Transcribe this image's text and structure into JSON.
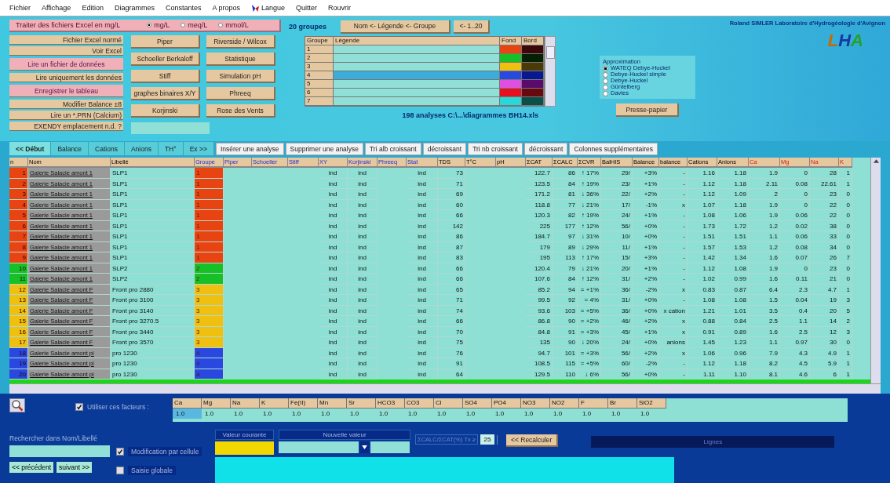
{
  "menu": [
    {
      "label": "Fichier"
    },
    {
      "label": "Affichage"
    },
    {
      "label": "Edition"
    },
    {
      "label": "Diagrammes"
    },
    {
      "label": "Constantes"
    },
    {
      "label": "A propos"
    },
    {
      "label": "Langue",
      "kind": "flag"
    },
    {
      "label": "Quitter"
    },
    {
      "label": "Rouvrir"
    }
  ],
  "excel_bar": {
    "label": "Traiter des fichiers Excel en mg/L",
    "units": [
      {
        "label": "mg/L",
        "selected": true
      },
      {
        "label": "meq/L",
        "selected": false
      },
      {
        "label": "mmol/L",
        "selected": false
      }
    ]
  },
  "file_buttons": [
    {
      "label": "Fichier Excel normé",
      "kind": "plain"
    },
    {
      "label": "Voir Excel",
      "kind": "plain"
    },
    {
      "label": "Lire un fichier de données",
      "kind": "pink"
    },
    {
      "label": "Lire uniquement les données",
      "kind": "plain"
    },
    {
      "label": "Enregistrer le tableau",
      "kind": "pink"
    },
    {
      "label": "Modifier Balance ±8",
      "kind": "plain"
    },
    {
      "label": "Lire un *.PRN (Calcium)",
      "kind": "plain"
    },
    {
      "label": "EXENDY emplacement n.d. ?",
      "kind": "plain"
    }
  ],
  "diagram_buttons": [
    "Piper",
    "Schoeller Berkaloff",
    "Stiff",
    "graphes binaires X/Y",
    "Korjinski"
  ],
  "tool_buttons": [
    "Riverside / Wilcox",
    "Statistique",
    "Simulation pH",
    "Phreeq",
    "Rose des Vents"
  ],
  "file_path": "198 analyses C:\\...\\diagrammes BH14.xls",
  "groups": {
    "count": "20 groupes",
    "name_button": "Nom <- Légende <- Groupe",
    "range_button": "<- 1..20",
    "columns": [
      "Groupe",
      "Légende",
      "Fond",
      "Bord"
    ],
    "rows": [
      {
        "groupe": "1",
        "swatches": [
          {
            "color": "#e84412"
          },
          {
            "color": "#3a0808"
          }
        ],
        "selected": false
      },
      {
        "groupe": "2",
        "swatches": [
          {
            "color": "#18c028"
          },
          {
            "color": "#062006"
          }
        ],
        "selected": false
      },
      {
        "groupe": "3",
        "swatches": [
          {
            "color": "#f0c010"
          },
          {
            "color": "#4a3a08"
          }
        ],
        "selected": false
      },
      {
        "groupe": "4",
        "swatches": [
          {
            "color": "#2848e0"
          },
          {
            "color": "#081890"
          }
        ],
        "selected": true
      },
      {
        "groupe": "5",
        "swatches": [
          {
            "color": "#e050e0"
          },
          {
            "color": "#5a0a6a"
          }
        ],
        "selected": false
      },
      {
        "groupe": "6",
        "swatches": [
          {
            "color": "#e81020"
          },
          {
            "color": "#6a0810"
          }
        ],
        "selected": false
      },
      {
        "groupe": "7",
        "swatches": [
          {
            "color": "#28d8d8"
          },
          {
            "color": "#0a5048"
          }
        ],
        "selected": false
      }
    ]
  },
  "approximation": {
    "title": "Approximation",
    "options": [
      {
        "label": "WATEQ Debye-Huckel",
        "selected": true
      },
      {
        "label": "Debye-Huckel simple",
        "selected": false
      },
      {
        "label": "Debye-Huckel",
        "selected": false
      },
      {
        "label": "Güntelberg",
        "selected": false
      },
      {
        "label": "Davies",
        "selected": false
      }
    ],
    "clipboard_button": "Presse-papier"
  },
  "author": "Roland SIMLER Laboratoire d'Hydrogéologie d'Avignon",
  "logo": [
    {
      "letter": "L",
      "color": "#c86a00"
    },
    {
      "letter": "H",
      "color": "#1838a0"
    },
    {
      "letter": "A",
      "color": "#28a028"
    }
  ],
  "tabs": [
    {
      "label": "<< Début",
      "selected": true
    },
    {
      "label": "Balance",
      "selected": false
    },
    {
      "label": "Cations",
      "selected": false
    },
    {
      "label": "Anions",
      "selected": false
    },
    {
      "label": "TH°",
      "selected": false
    },
    {
      "label": "Ex >>",
      "selected": false
    }
  ],
  "actions": [
    "Insérer une analyse",
    "Supprimer une analyse",
    "Tri alb croissant",
    "décroissant",
    "Tri nb croissant",
    "décroissant",
    "Colonnes supplémentaires"
  ],
  "table": {
    "columns": [
      {
        "label": "n",
        "kind": "plain"
      },
      {
        "label": "Nom",
        "kind": "plain"
      },
      {
        "label": "Libellé",
        "kind": "plain"
      },
      {
        "label": "Groupe",
        "kind": "plot"
      },
      {
        "label": "Piper",
        "kind": "plot"
      },
      {
        "label": "Schoeller",
        "kind": "plot"
      },
      {
        "label": "Stiff",
        "kind": "plot"
      },
      {
        "label": "XY",
        "kind": "plot"
      },
      {
        "label": "Korjinski",
        "kind": "plot"
      },
      {
        "label": "Phreeq",
        "kind": "plot"
      },
      {
        "label": "Stat",
        "kind": "plot"
      },
      {
        "label": "TDS",
        "kind": "plain"
      },
      {
        "label": "T°C",
        "kind": "plain"
      },
      {
        "label": "pH",
        "kind": "plain"
      },
      {
        "label": "ΣCAT",
        "kind": "plain"
      },
      {
        "label": "ΣCALC",
        "kind": "plain"
      },
      {
        "label": "ΣCVR",
        "kind": "plain"
      },
      {
        "label": "BalHIS",
        "kind": "plain"
      },
      {
        "label": "Balance",
        "kind": "plain"
      },
      {
        "label": "balance",
        "kind": "plain"
      },
      {
        "label": "Cations",
        "kind": "plain"
      },
      {
        "label": "Anions",
        "kind": "plain"
      },
      {
        "label": "Ca",
        "kind": "ion"
      },
      {
        "label": "Mg",
        "kind": "ion"
      },
      {
        "label": "Na",
        "kind": "ion"
      },
      {
        "label": "K",
        "kind": "ion"
      }
    ],
    "rows": [
      {
        "color": "#e84412",
        "n": "1",
        "nom": "Galerie Salacie amont 1",
        "lib": "SLP1",
        "grp": "1",
        "xy": "ind",
        "kor": "ind",
        "stat": "ind",
        "tds": "73",
        "cat": "122.7",
        "calc": "86",
        "cvr": "↑ 17%",
        "bh": "29/",
        "bal": "+3%",
        "rem": "-",
        "cations": "1.16",
        "anions": "1.18",
        "ca": "1.9",
        "mg": "0",
        "na": "28",
        "k": "1"
      },
      {
        "color": "#e84412",
        "n": "2",
        "nom": "Galerie Salacie amont 1",
        "lib": "SLP1",
        "grp": "1",
        "xy": "ind",
        "kor": "ind",
        "stat": "ind",
        "tds": "71",
        "cat": "123.5",
        "calc": "84",
        "cvr": "↑ 19%",
        "bh": "23/",
        "bal": "+1%",
        "rem": "-",
        "cations": "1.12",
        "anions": "1.18",
        "ca": "2.11",
        "mg": "0.08",
        "na": "22.61",
        "k": "1"
      },
      {
        "color": "#e84412",
        "n": "3",
        "nom": "Galerie Salacie amont 1",
        "lib": "SLP1",
        "grp": "1",
        "xy": "ind",
        "kor": "ind",
        "stat": "ind",
        "tds": "69",
        "cat": "171.2",
        "calc": "81",
        "cvr": "↓ 36%",
        "bh": "22/",
        "bal": "+2%",
        "rem": "-",
        "cations": "1.12",
        "anions": "1.09",
        "ca": "2",
        "mg": "0",
        "na": "23",
        "k": "0"
      },
      {
        "color": "#e84412",
        "n": "4",
        "nom": "Galerie Salacie amont 1",
        "lib": "SLP1",
        "grp": "1",
        "xy": "ind",
        "kor": "ind",
        "stat": "ind",
        "tds": "60",
        "cat": "118.8",
        "calc": "77",
        "cvr": "↓ 21%",
        "bh": "17/",
        "bal": "-1%",
        "rem": "x",
        "cations": "1.07",
        "anions": "1.18",
        "ca": "1.9",
        "mg": "0",
        "na": "22",
        "k": "0"
      },
      {
        "color": "#e84412",
        "n": "5",
        "nom": "Galerie Salacie amont 1",
        "lib": "SLP1",
        "grp": "1",
        "xy": "ind",
        "kor": "ind",
        "stat": "ind",
        "tds": "66",
        "cat": "120.3",
        "calc": "82",
        "cvr": "↑ 19%",
        "bh": "24/",
        "bal": "+1%",
        "rem": "-",
        "cations": "1.08",
        "anions": "1.06",
        "ca": "1.9",
        "mg": "0.06",
        "na": "22",
        "k": "0"
      },
      {
        "color": "#e84412",
        "n": "6",
        "nom": "Galerie Salacie amont 1",
        "lib": "SLP1",
        "grp": "1",
        "xy": "ind",
        "kor": "ind",
        "stat": "ind",
        "tds": "142",
        "cat": "225",
        "calc": "177",
        "cvr": "↑ 12%",
        "bh": "56/",
        "bal": "+0%",
        "rem": "-",
        "cations": "1.73",
        "anions": "1.72",
        "ca": "1.2",
        "mg": "0.02",
        "na": "38",
        "k": "0"
      },
      {
        "color": "#e84412",
        "n": "7",
        "nom": "Galerie Salacie amont 1",
        "lib": "SLP1",
        "grp": "1",
        "xy": "ind",
        "kor": "ind",
        "stat": "ind",
        "tds": "86",
        "cat": "184.7",
        "calc": "97",
        "cvr": "↓ 31%",
        "bh": "10/",
        "bal": "+0%",
        "rem": "-",
        "cations": "1.51",
        "anions": "1.51",
        "ca": "1.1",
        "mg": "0.06",
        "na": "33",
        "k": "0"
      },
      {
        "color": "#e84412",
        "n": "8",
        "nom": "Galerie Salacie amont 1",
        "lib": "SLP1",
        "grp": "1",
        "xy": "ind",
        "kor": "ind",
        "stat": "ind",
        "tds": "87",
        "cat": "179",
        "calc": "89",
        "cvr": "↓ 29%",
        "bh": "11/",
        "bal": "+1%",
        "rem": "-",
        "cations": "1.57",
        "anions": "1.53",
        "ca": "1.2",
        "mg": "0.08",
        "na": "34",
        "k": "0"
      },
      {
        "color": "#e84412",
        "n": "9",
        "nom": "Galerie Salacie amont 1",
        "lib": "SLP1",
        "grp": "1",
        "xy": "ind",
        "kor": "ind",
        "stat": "ind",
        "tds": "83",
        "cat": "195",
        "calc": "113",
        "cvr": "↑ 17%",
        "bh": "15/",
        "bal": "+3%",
        "rem": "-",
        "cations": "1.42",
        "anions": "1.34",
        "ca": "1.6",
        "mg": "0.07",
        "na": "26",
        "k": "7"
      },
      {
        "color": "#18c028",
        "n": "10",
        "nom": "Galerie Salacie amont 1",
        "lib": "SLP2",
        "grp": "2",
        "xy": "ind",
        "kor": "ind",
        "stat": "ind",
        "tds": "66",
        "cat": "120.4",
        "calc": "79",
        "cvr": "↓ 21%",
        "bh": "20/",
        "bal": "+1%",
        "rem": "-",
        "cations": "1.12",
        "anions": "1.08",
        "ca": "1.9",
        "mg": "0",
        "na": "23",
        "k": "0"
      },
      {
        "color": "#18c028",
        "n": "11",
        "nom": "Galerie Salacie amont 1",
        "lib": "SLP2",
        "grp": "2",
        "xy": "ind",
        "kor": "ind",
        "stat": "ind",
        "tds": "66",
        "cat": "107.6",
        "calc": "84",
        "cvr": "↑ 12%",
        "bh": "31/",
        "bal": "+2%",
        "rem": "-",
        "cations": "1.02",
        "anions": "0.99",
        "ca": "1.6",
        "mg": "0.11",
        "na": "21",
        "k": "0"
      },
      {
        "color": "#f0c010",
        "n": "12",
        "nom": "Galerie Salacie amont F",
        "lib": "Front pro 2880",
        "grp": "3",
        "xy": "ind",
        "kor": "ind",
        "stat": "ind",
        "tds": "65",
        "cat": "85.2",
        "calc": "94",
        "cvr": "= +1%",
        "bh": "36/",
        "bal": "-2%",
        "rem": "x",
        "cations": "0.83",
        "anions": "0.87",
        "ca": "6.4",
        "mg": "2.3",
        "na": "4.7",
        "k": "1"
      },
      {
        "color": "#f0c010",
        "n": "13",
        "nom": "Galerie Salacie amont F",
        "lib": "Front pro 3100",
        "grp": "3",
        "xy": "ind",
        "kor": "ind",
        "stat": "ind",
        "tds": "71",
        "cat": "99.5",
        "calc": "92",
        "cvr": "= 4%",
        "bh": "31/",
        "bal": "+0%",
        "rem": "-",
        "cations": "1.08",
        "anions": "1.08",
        "ca": "1.5",
        "mg": "0.04",
        "na": "19",
        "k": "3"
      },
      {
        "color": "#f0c010",
        "n": "14",
        "nom": "Galerie Salacie amont F",
        "lib": "Front pro 3140",
        "grp": "3",
        "xy": "ind",
        "kor": "ind",
        "stat": "ind",
        "tds": "74",
        "cat": "93.6",
        "calc": "103",
        "cvr": "= +5%",
        "bh": "36/",
        "bal": "+0%",
        "rem": "x cation",
        "cations": "1.21",
        "anions": "1.01",
        "ca": "3.5",
        "mg": "0.4",
        "na": "20",
        "k": "5"
      },
      {
        "color": "#f0c010",
        "n": "15",
        "nom": "Galerie Salacie amont F",
        "lib": "Front pro 3270.5",
        "grp": "3",
        "xy": "ind",
        "kor": "ind",
        "stat": "ind",
        "tds": "66",
        "cat": "86.8",
        "calc": "90",
        "cvr": "= +2%",
        "bh": "46/",
        "bal": "+2%",
        "rem": "x",
        "cations": "0.88",
        "anions": "0.84",
        "ca": "2.5",
        "mg": "1.1",
        "na": "14",
        "k": "2"
      },
      {
        "color": "#f0c010",
        "n": "16",
        "nom": "Galerie Salacie amont F",
        "lib": "Front pro 3440",
        "grp": "3",
        "xy": "ind",
        "kor": "ind",
        "stat": "ind",
        "tds": "70",
        "cat": "84.8",
        "calc": "91",
        "cvr": "= +3%",
        "bh": "45/",
        "bal": "+1%",
        "rem": "x",
        "cations": "0.91",
        "anions": "0.89",
        "ca": "1.6",
        "mg": "2.5",
        "na": "12",
        "k": "3"
      },
      {
        "color": "#f0c010",
        "n": "17",
        "nom": "Galerie Salacie amont F",
        "lib": "Front pro 3570",
        "grp": "3",
        "xy": "ind",
        "kor": "ind",
        "stat": "ind",
        "tds": "75",
        "cat": "135",
        "calc": "90",
        "cvr": "↓ 20%",
        "bh": "24/",
        "bal": "+0%",
        "rem": "anions",
        "cations": "1.45",
        "anions": "1.23",
        "ca": "1.1",
        "mg": "0.97",
        "na": "30",
        "k": "0"
      },
      {
        "color": "#2848e0",
        "n": "18",
        "nom": "Galerie Salacie amont pi",
        "lib": "pro 1230",
        "grp": "4",
        "xy": "ind",
        "kor": "ind",
        "stat": "ind",
        "tds": "76",
        "cat": "94.7",
        "calc": "101",
        "cvr": "= +3%",
        "bh": "56/",
        "bal": "+2%",
        "rem": "x",
        "cations": "1.06",
        "anions": "0.96",
        "ca": "7.9",
        "mg": "4.3",
        "na": "4.9",
        "k": "1"
      },
      {
        "color": "#2848e0",
        "n": "19",
        "nom": "Galerie Salacie amont pi",
        "lib": "pro 1230",
        "grp": "4",
        "xy": "ind",
        "kor": "ind",
        "stat": "ind",
        "tds": "91",
        "cat": "108.5",
        "calc": "115",
        "cvr": "= +5%",
        "bh": "60/",
        "bal": "-2%",
        "rem": "-",
        "cations": "1.12",
        "anions": "1.18",
        "ca": "8.2",
        "mg": "4.5",
        "na": "5.9",
        "k": "1"
      },
      {
        "color": "#2848e0",
        "n": "20",
        "nom": "Galerie Salacie amont pi",
        "lib": "pro 1230",
        "grp": "4",
        "xy": "ind",
        "kor": "ind",
        "stat": "ind",
        "tds": "64",
        "cat": "129.5",
        "calc": "110",
        "cvr": "↓ 6%",
        "bh": "56/",
        "bal": "+0%",
        "rem": "-",
        "cations": "1.11",
        "anions": "1.10",
        "ca": "8.1",
        "mg": "4.6",
        "na": "6",
        "k": "1"
      }
    ]
  },
  "factors": {
    "use_label": "Utiliser ces facteurs :",
    "use_checked": true,
    "items": [
      {
        "ion": "Ca",
        "value": "1.0",
        "selected": true
      },
      {
        "ion": "Mg",
        "value": "1.0",
        "selected": false
      },
      {
        "ion": "Na",
        "value": "1.0",
        "selected": false
      },
      {
        "ion": "K",
        "value": "1.0",
        "selected": false
      },
      {
        "ion": "Fe(II)",
        "value": "1.0",
        "selected": false
      },
      {
        "ion": "Mn",
        "value": "1.0",
        "selected": false
      },
      {
        "ion": "Sr",
        "value": "1.0",
        "selected": false
      },
      {
        "ion": "HCO3",
        "value": "1.0",
        "selected": false
      },
      {
        "ion": "CO3",
        "value": "1.0",
        "selected": false
      },
      {
        "ion": "Cl",
        "value": "1.0",
        "selected": false
      },
      {
        "ion": "SO4",
        "value": "1.0",
        "selected": false
      },
      {
        "ion": "PO4",
        "value": "1.0",
        "selected": false
      },
      {
        "ion": "NO3",
        "value": "1.0",
        "selected": false
      },
      {
        "ion": "NO2",
        "value": "1.0",
        "selected": false
      },
      {
        "ion": "F",
        "value": "1.0",
        "selected": false
      },
      {
        "ion": "Br",
        "value": "1.0",
        "selected": false
      },
      {
        "ion": "SiO2",
        "value": "1.0",
        "selected": false
      }
    ]
  },
  "search": {
    "label": "Rechercher dans Nom/Libellé",
    "prev_button": "<< précédent",
    "next_button": "suivant >>"
  },
  "edit_modes": [
    {
      "label": "Modification par cellule",
      "checked": true
    },
    {
      "label": "Saisie globale",
      "checked": false
    }
  ],
  "current_value": {
    "label": "Valeur courante"
  },
  "new_value": {
    "label": "Nouvelle valeur"
  },
  "threshold": {
    "label": "ΣCALC/ΣCAT(%) Tx ≥",
    "value": "25"
  },
  "recalc_button": "<< Recalculer",
  "lines_box": "Lignes"
}
